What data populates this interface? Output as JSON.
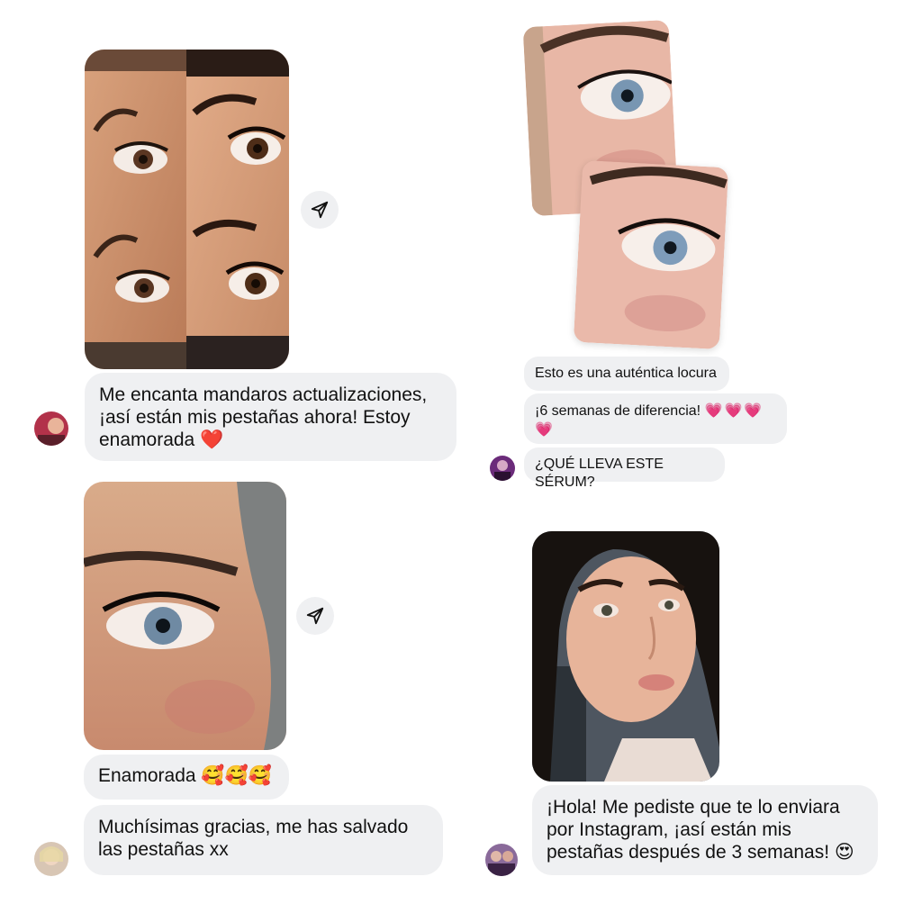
{
  "messages": {
    "m1": {
      "text": "Me encanta mandaros actualizaciones, ¡así están mis pestañas ahora! Estoy enamorada",
      "emoji": "❤️"
    },
    "m2": {
      "line1": "Esto es una auténtica locura",
      "line2": "¡6 semanas de diferencia!",
      "line2_emoji": "💗💗💗💗",
      "line3": "¿QUÉ LLEVA ESTE SÉRUM?"
    },
    "m3": {
      "line1": "Enamorada",
      "line1_emoji": "🥰🥰🥰",
      "line2": "Muchísimas gracias, me has salvado las pestañas xx"
    },
    "m4": {
      "text": "¡Hola! Me pediste que te lo enviara por Instagram, ¡así están mis pestañas después de 3 semanas!",
      "emoji": "😍"
    }
  },
  "icons": {
    "share": "paper-plane-icon",
    "avatar": "user-avatar"
  },
  "colors": {
    "bubble": "#eff0f2",
    "background": "#ffffff",
    "heart": "#e0245e",
    "pink_heart": "#f06bb8"
  }
}
